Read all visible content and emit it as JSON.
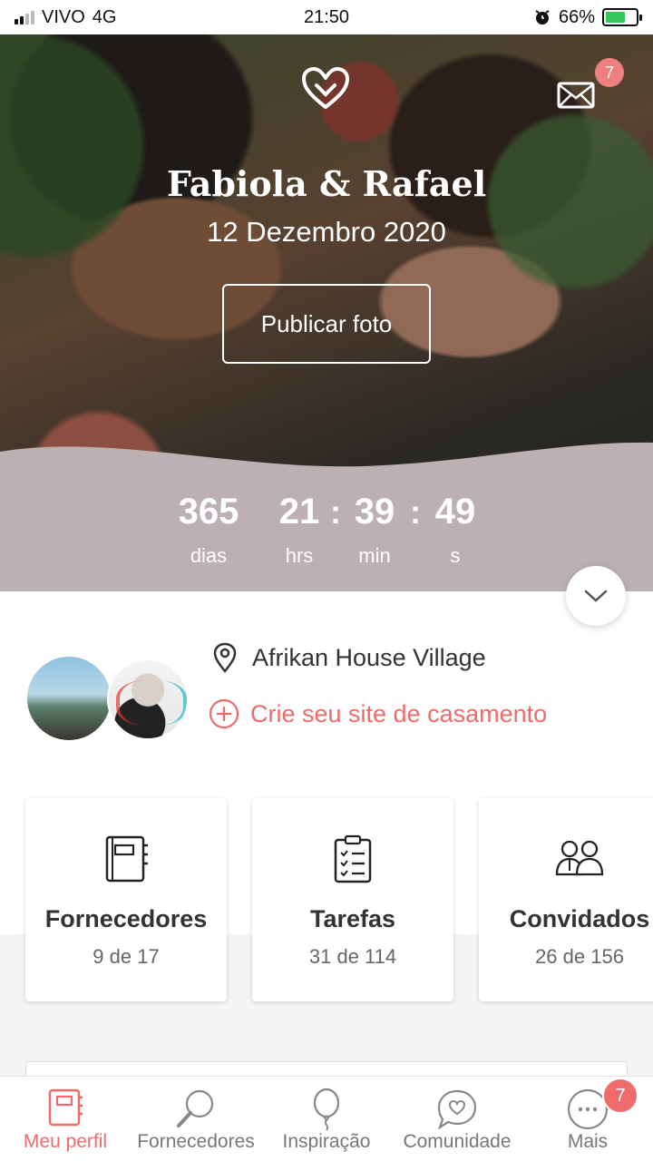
{
  "status_bar": {
    "carrier": "VIVO",
    "network": "4G",
    "time": "21:50",
    "battery": "66%",
    "battery_level": 0.66
  },
  "hero": {
    "couple_names": "Fabiola & Rafael",
    "wedding_date": "12 Dezembro 2020",
    "publish_button": "Publicar foto",
    "mail_badge": "7"
  },
  "countdown": {
    "days": "365",
    "days_label": "dias",
    "hours": "21",
    "hours_label": "hrs",
    "minutes": "39",
    "minutes_label": "min",
    "seconds": "49",
    "seconds_label": "s",
    "separator": ":"
  },
  "profile": {
    "venue": "Afrikan House Village",
    "create_site_link": "Crie seu site de casamento"
  },
  "cards": [
    {
      "title": "Fornecedores",
      "count": "9 de 17",
      "icon": "notebook-icon"
    },
    {
      "title": "Tarefas",
      "count": "31 de 114",
      "icon": "checklist-icon"
    },
    {
      "title": "Convidados",
      "count": "26 de 156",
      "icon": "guests-icon"
    }
  ],
  "bottom_nav": {
    "items": [
      {
        "label": "Meu perfil",
        "icon": "notebook-icon",
        "active": true
      },
      {
        "label": "Fornecedores",
        "icon": "search-icon"
      },
      {
        "label": "Inspiração",
        "icon": "balloon-icon"
      },
      {
        "label": "Comunidade",
        "icon": "chat-heart-icon"
      },
      {
        "label": "Mais",
        "icon": "more-icon"
      }
    ],
    "more_badge": "7"
  },
  "colors": {
    "accent": "#ef6b6b",
    "countdown_band": "#bdb0b3",
    "battery_green": "#35c759"
  }
}
